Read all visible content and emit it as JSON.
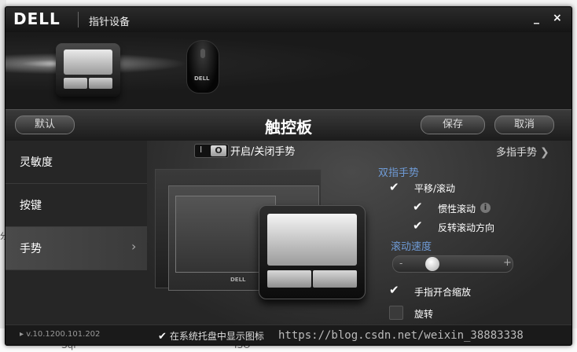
{
  "window": {
    "logo": "DELL",
    "title": "指针设备",
    "minimize": "_",
    "close": "×"
  },
  "devices": {
    "mouse_logo": "DELL"
  },
  "toolbar": {
    "default_label": "默认",
    "title": "触控板",
    "save_label": "保存",
    "cancel_label": "取消"
  },
  "sidebar": {
    "items": [
      {
        "label": "灵敏度"
      },
      {
        "label": "按键"
      },
      {
        "label": "手势"
      }
    ]
  },
  "gestures": {
    "switch_i": "I",
    "switch_o": "O",
    "switch_label": "开启/关闭手势",
    "multi_finger": "多指手势",
    "two_finger_title": "双指手势",
    "pan_scroll": "平移/滚动",
    "inertia_scroll": "惯性滚动",
    "reverse_scroll": "反转滚动方向",
    "scroll_speed_title": "滚动速度",
    "speed_minus": "-",
    "speed_plus": "+",
    "speed_level": 0.2,
    "pinch_zoom": "手指开合缩放",
    "rotate": "旋转",
    "laptop_brand": "DELL"
  },
  "status": {
    "version": "v.10.1200.101.202",
    "tray_label": "在系统托盘中显示图标"
  },
  "background": {
    "left_text": "分",
    "bottom_left": "Sql",
    "bottom_mid": "ISO",
    "watermark": "https://blog.csdn.net/weixin_38883338"
  }
}
